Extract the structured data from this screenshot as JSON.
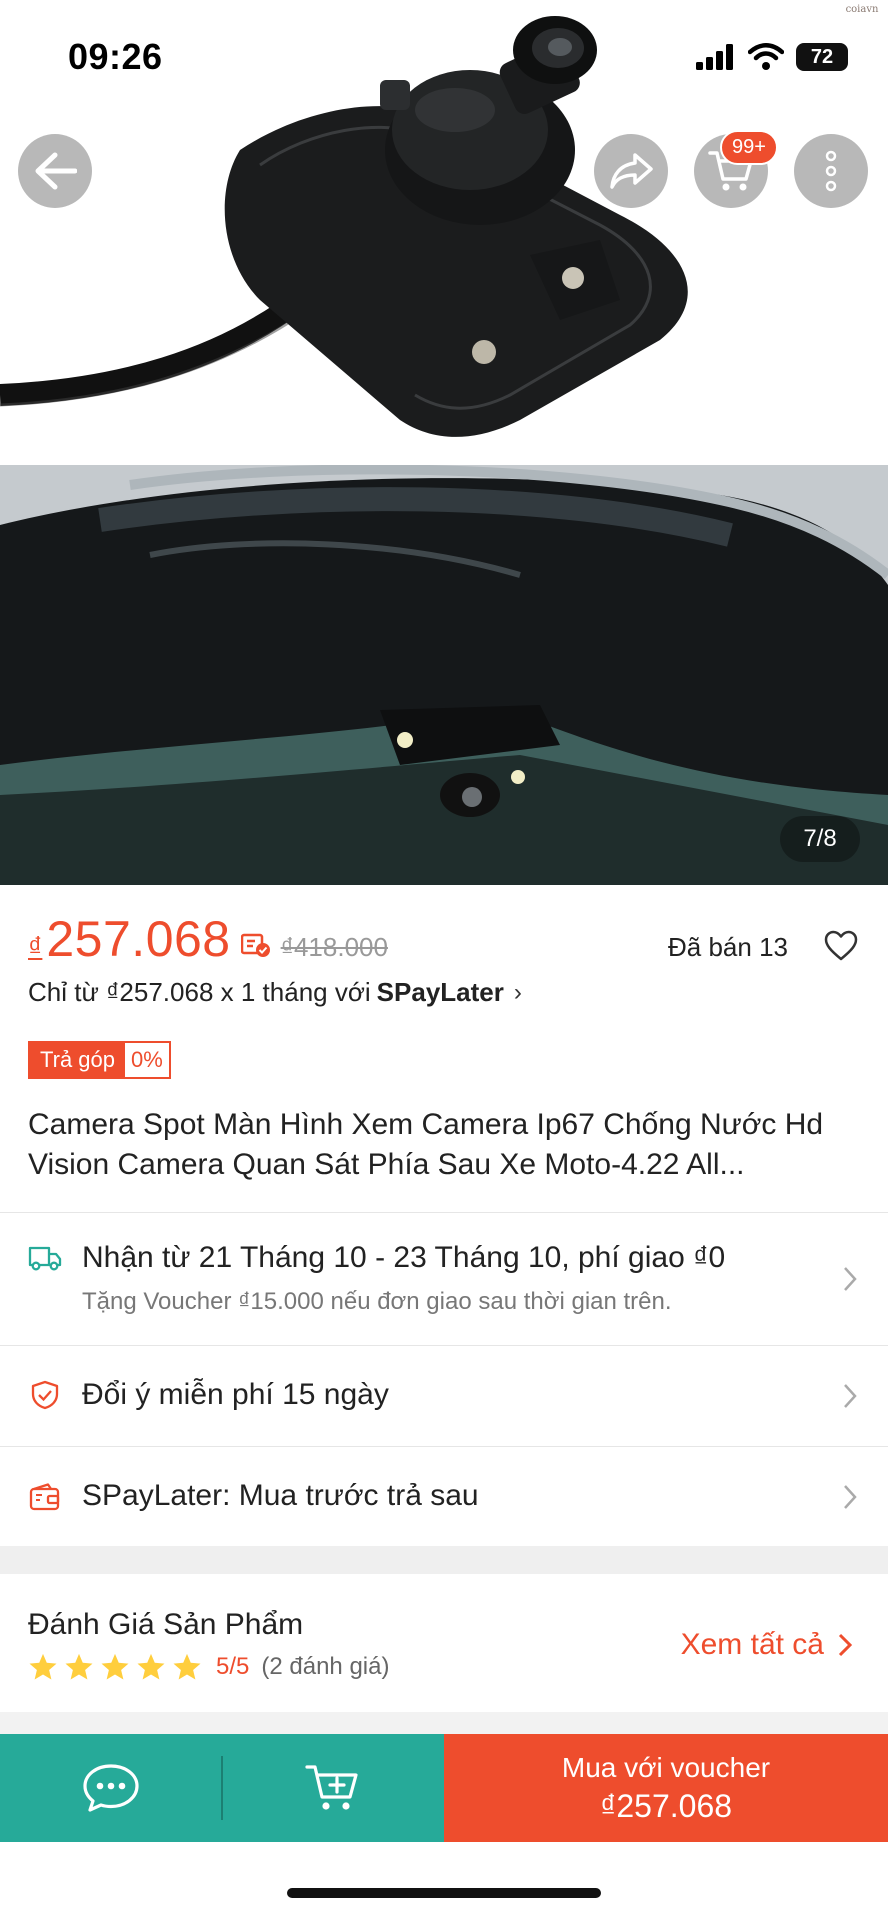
{
  "status_bar": {
    "time": "09:26",
    "battery": "72",
    "watermark": "coiavn"
  },
  "hero": {
    "image_counter": "7/8",
    "cart_badge": "99+"
  },
  "price": {
    "currency_symbol": "₫",
    "current": "257.068",
    "original": "₫418.000",
    "sold": "Đã bán 13"
  },
  "spaylater": {
    "prefix": "Chỉ từ ₫257.068 x 1 tháng với",
    "brand": "SPayLater",
    "chevron": "›"
  },
  "installment": {
    "label": "Trả góp",
    "rate": "0%"
  },
  "product": {
    "title": "Camera Spot Màn Hình Xem Camera Ip67 Chống Nước Hd Vision Camera Quan Sát Phía Sau Xe Moto-4.22 All..."
  },
  "rows": {
    "shipping_main": "Nhận từ 21 Tháng 10 - 23 Tháng 10, phí giao ₫0",
    "shipping_sub": "Tặng Voucher ₫15.000 nếu đơn giao sau thời gian trên.",
    "return": "Đổi ý miễn phí 15 ngày",
    "spaylater": "SPayLater: Mua trước trả sau"
  },
  "reviews": {
    "title": "Đánh Giá Sản Phẩm",
    "rating": "5/5",
    "count": "(2 đánh giá)",
    "see_all": "Xem tất cả",
    "stars": 5
  },
  "bottom_bar": {
    "buy_line1": "Mua với voucher",
    "buy_line2": "₫257.068"
  },
  "colors": {
    "accent": "#ee4d2d",
    "teal": "#26aa99",
    "star": "#ffce3d"
  }
}
